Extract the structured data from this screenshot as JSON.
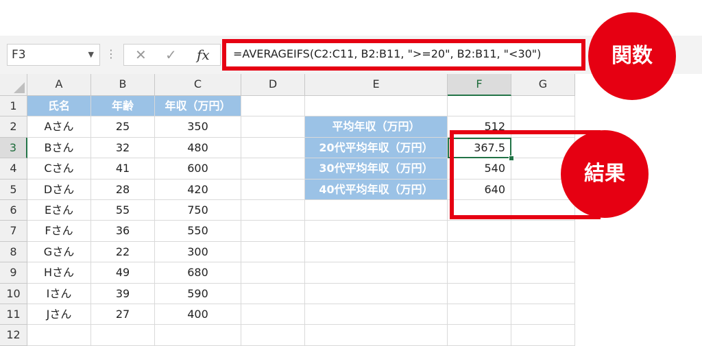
{
  "formula_bar": {
    "name_box": "F3",
    "cancel_icon": "✕",
    "enter_icon": "✓",
    "fx_label": "fx",
    "formula": "=AVERAGEIFS(C2:C11, B2:B11, \">=20\", B2:B11, \"<30\")"
  },
  "columns": [
    "A",
    "B",
    "C",
    "D",
    "E",
    "F",
    "G"
  ],
  "active_column": "F",
  "active_row": "3",
  "rows": [
    "1",
    "2",
    "3",
    "4",
    "5",
    "6",
    "7",
    "8",
    "9",
    "10",
    "11",
    "12"
  ],
  "table": {
    "headers": [
      "氏名",
      "年齢",
      "年収（万円）"
    ],
    "rows": [
      [
        "Aさん",
        "25",
        "350"
      ],
      [
        "Bさん",
        "32",
        "480"
      ],
      [
        "Cさん",
        "41",
        "600"
      ],
      [
        "Dさん",
        "28",
        "420"
      ],
      [
        "Eさん",
        "55",
        "750"
      ],
      [
        "Fさん",
        "36",
        "550"
      ],
      [
        "Gさん",
        "22",
        "300"
      ],
      [
        "Hさん",
        "49",
        "680"
      ],
      [
        "Iさん",
        "39",
        "590"
      ],
      [
        "Jさん",
        "27",
        "400"
      ]
    ]
  },
  "summary": [
    {
      "label": "平均年収（万円）",
      "value": "512"
    },
    {
      "label": "20代平均年収（万円）",
      "value": "367.5"
    },
    {
      "label": "30代平均年収（万円）",
      "value": "540"
    },
    {
      "label": "40代平均年収（万円）",
      "value": "640"
    }
  ],
  "callouts": {
    "function_label": "関数",
    "result_label": "結果"
  },
  "colors": {
    "accent_red": "#e60012",
    "header_blue": "#9bc2e6",
    "excel_green": "#217346"
  }
}
